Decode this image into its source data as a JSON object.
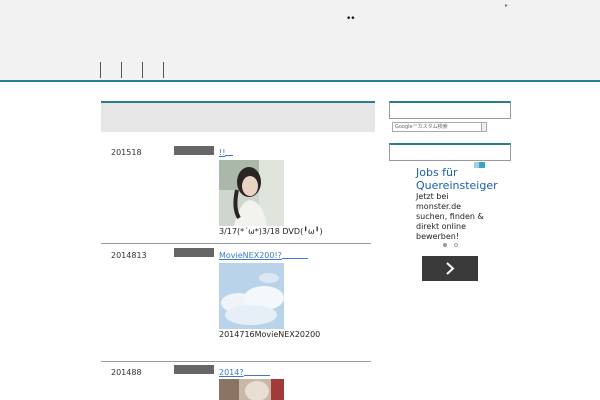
{
  "header": {
    "logo_glyph": "••",
    "corner_glyph": "▸",
    "nav_items": [
      "",
      "",
      "",
      ""
    ]
  },
  "main": {
    "posts": [
      {
        "date": "201518",
        "link_text": "!!",
        "excerpt": "3/17(*´ω*)3/18 DVD(╹ω╹)"
      },
      {
        "date": "2014813",
        "link_text": "MovieNEX200!?",
        "excerpt": "2014716MovieNEX20200"
      },
      {
        "date": "201488",
        "link_text": "2014?",
        "excerpt": ""
      }
    ]
  },
  "sidebar": {
    "search_placeholder": "Google™カスタム検索"
  },
  "ad": {
    "title": "Jobs für Quereinsteiger",
    "body": "Jetzt bei monster.de suchen, finden & direkt online bewerben!",
    "next_icon": "chevron-right-icon"
  },
  "colors": {
    "accent": "#2e7d8c",
    "link": "#3a7ac7",
    "ad_title": "#1a5fb4"
  }
}
